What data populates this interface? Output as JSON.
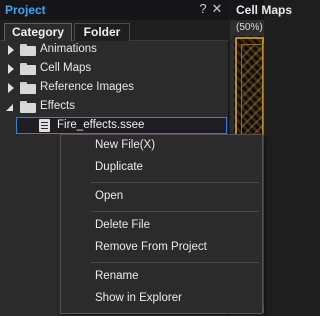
{
  "project_panel": {
    "title": "Project",
    "help_glyph": "?",
    "close_glyph": "✕",
    "tabs": [
      {
        "label": "Category",
        "active": true
      },
      {
        "label": "Folder",
        "active": false
      }
    ],
    "tree": [
      {
        "label": "Animations",
        "expanded": false
      },
      {
        "label": "Cell Maps",
        "expanded": false
      },
      {
        "label": "Reference Images",
        "expanded": false
      },
      {
        "label": "Effects",
        "expanded": true
      }
    ],
    "selected_file": {
      "label": "Fire_effects.ssee",
      "icon": "document-icon"
    }
  },
  "cell_maps_panel": {
    "title": "Cell Maps",
    "zoom": "(50%)"
  },
  "context_menu": {
    "items": [
      {
        "label": "New File(X)"
      },
      {
        "label": "Duplicate"
      },
      {
        "label": "Open"
      },
      {
        "label": "Delete File"
      },
      {
        "label": "Remove From Project"
      },
      {
        "label": "Rename"
      },
      {
        "label": "Show in Explorer"
      }
    ]
  },
  "colors": {
    "accent_title": "#3ea6f0",
    "selection_border": "#3a7bd5",
    "panel_bg": "#2b2b2b",
    "titlebar_bg": "#16161a"
  }
}
